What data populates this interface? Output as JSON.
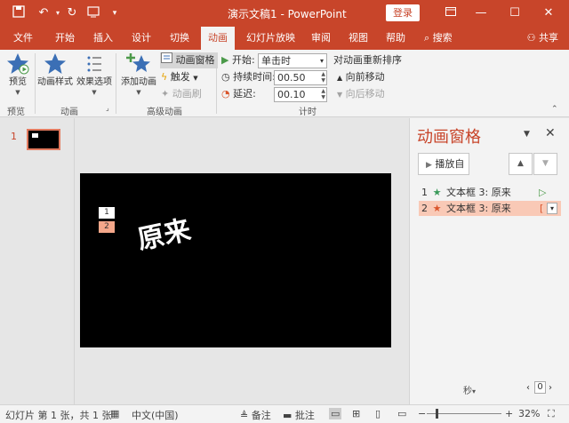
{
  "titlebar": {
    "title": "演示文稿1  -  PowerPoint",
    "login": "登录",
    "icons": [
      "save-icon",
      "undo-icon",
      "redo-icon",
      "present-icon",
      "customize-icon"
    ]
  },
  "tabs": [
    {
      "label": "文件"
    },
    {
      "label": "开始"
    },
    {
      "label": "插入"
    },
    {
      "label": "设计"
    },
    {
      "label": "切换"
    },
    {
      "label": "动画",
      "active": true
    },
    {
      "label": "幻灯片放映"
    },
    {
      "label": "审阅"
    },
    {
      "label": "视图"
    },
    {
      "label": "帮助"
    },
    {
      "label": "搜索"
    }
  ],
  "share": "共享",
  "ribbon": {
    "preview": {
      "button": "预览",
      "group": "预览"
    },
    "animation": {
      "style_button": "动画样式",
      "effect_button": "效果选项",
      "group": "动画"
    },
    "advanced": {
      "add_button": "添加动画",
      "pane_button": "动画窗格",
      "trigger": "触发",
      "painter": "动画刷",
      "group": "高级动画"
    },
    "timing": {
      "start_label": "开始:",
      "start_value": "单击时",
      "duration_label": "持续时间:",
      "duration_value": "00.50",
      "delay_label": "延迟:",
      "delay_value": "00.10",
      "reorder_title": "对动画重新排序",
      "move_earlier": "向前移动",
      "move_later": "向后移动",
      "group": "计时"
    }
  },
  "thumbnail": {
    "number": "1"
  },
  "slide": {
    "tags": [
      "1",
      "2"
    ],
    "text": "原来"
  },
  "anim_pane": {
    "title": "动画窗格",
    "play_button": "播放自",
    "items": [
      {
        "num": "1",
        "label": "文本框 3: 原来",
        "star_color": "#3a9a5a"
      },
      {
        "num": "2",
        "label": "文本框 3: 原来",
        "star_color": "#d9542b"
      }
    ],
    "seconds_label": "秒",
    "zoom_value": "0"
  },
  "status": {
    "slide_info": "幻灯片 第 1 张，共 1 张",
    "language": "中文(中国)",
    "notes": "备注",
    "comments": "批注",
    "zoom": "32%"
  },
  "colors": {
    "accent": "#c8452a",
    "selected": "#f9c9b6"
  }
}
